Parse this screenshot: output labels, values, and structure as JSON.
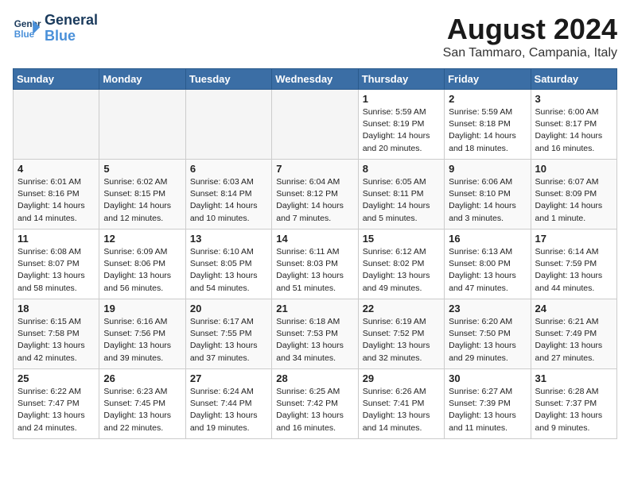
{
  "logo": {
    "line1": "General",
    "line2": "Blue"
  },
  "title": "August 2024",
  "location": "San Tammaro, Campania, Italy",
  "days_of_week": [
    "Sunday",
    "Monday",
    "Tuesday",
    "Wednesday",
    "Thursday",
    "Friday",
    "Saturday"
  ],
  "weeks": [
    [
      {
        "num": "",
        "info": ""
      },
      {
        "num": "",
        "info": ""
      },
      {
        "num": "",
        "info": ""
      },
      {
        "num": "",
        "info": ""
      },
      {
        "num": "1",
        "info": "Sunrise: 5:59 AM\nSunset: 8:19 PM\nDaylight: 14 hours\nand 20 minutes."
      },
      {
        "num": "2",
        "info": "Sunrise: 5:59 AM\nSunset: 8:18 PM\nDaylight: 14 hours\nand 18 minutes."
      },
      {
        "num": "3",
        "info": "Sunrise: 6:00 AM\nSunset: 8:17 PM\nDaylight: 14 hours\nand 16 minutes."
      }
    ],
    [
      {
        "num": "4",
        "info": "Sunrise: 6:01 AM\nSunset: 8:16 PM\nDaylight: 14 hours\nand 14 minutes."
      },
      {
        "num": "5",
        "info": "Sunrise: 6:02 AM\nSunset: 8:15 PM\nDaylight: 14 hours\nand 12 minutes."
      },
      {
        "num": "6",
        "info": "Sunrise: 6:03 AM\nSunset: 8:14 PM\nDaylight: 14 hours\nand 10 minutes."
      },
      {
        "num": "7",
        "info": "Sunrise: 6:04 AM\nSunset: 8:12 PM\nDaylight: 14 hours\nand 7 minutes."
      },
      {
        "num": "8",
        "info": "Sunrise: 6:05 AM\nSunset: 8:11 PM\nDaylight: 14 hours\nand 5 minutes."
      },
      {
        "num": "9",
        "info": "Sunrise: 6:06 AM\nSunset: 8:10 PM\nDaylight: 14 hours\nand 3 minutes."
      },
      {
        "num": "10",
        "info": "Sunrise: 6:07 AM\nSunset: 8:09 PM\nDaylight: 14 hours\nand 1 minute."
      }
    ],
    [
      {
        "num": "11",
        "info": "Sunrise: 6:08 AM\nSunset: 8:07 PM\nDaylight: 13 hours\nand 58 minutes."
      },
      {
        "num": "12",
        "info": "Sunrise: 6:09 AM\nSunset: 8:06 PM\nDaylight: 13 hours\nand 56 minutes."
      },
      {
        "num": "13",
        "info": "Sunrise: 6:10 AM\nSunset: 8:05 PM\nDaylight: 13 hours\nand 54 minutes."
      },
      {
        "num": "14",
        "info": "Sunrise: 6:11 AM\nSunset: 8:03 PM\nDaylight: 13 hours\nand 51 minutes."
      },
      {
        "num": "15",
        "info": "Sunrise: 6:12 AM\nSunset: 8:02 PM\nDaylight: 13 hours\nand 49 minutes."
      },
      {
        "num": "16",
        "info": "Sunrise: 6:13 AM\nSunset: 8:00 PM\nDaylight: 13 hours\nand 47 minutes."
      },
      {
        "num": "17",
        "info": "Sunrise: 6:14 AM\nSunset: 7:59 PM\nDaylight: 13 hours\nand 44 minutes."
      }
    ],
    [
      {
        "num": "18",
        "info": "Sunrise: 6:15 AM\nSunset: 7:58 PM\nDaylight: 13 hours\nand 42 minutes."
      },
      {
        "num": "19",
        "info": "Sunrise: 6:16 AM\nSunset: 7:56 PM\nDaylight: 13 hours\nand 39 minutes."
      },
      {
        "num": "20",
        "info": "Sunrise: 6:17 AM\nSunset: 7:55 PM\nDaylight: 13 hours\nand 37 minutes."
      },
      {
        "num": "21",
        "info": "Sunrise: 6:18 AM\nSunset: 7:53 PM\nDaylight: 13 hours\nand 34 minutes."
      },
      {
        "num": "22",
        "info": "Sunrise: 6:19 AM\nSunset: 7:52 PM\nDaylight: 13 hours\nand 32 minutes."
      },
      {
        "num": "23",
        "info": "Sunrise: 6:20 AM\nSunset: 7:50 PM\nDaylight: 13 hours\nand 29 minutes."
      },
      {
        "num": "24",
        "info": "Sunrise: 6:21 AM\nSunset: 7:49 PM\nDaylight: 13 hours\nand 27 minutes."
      }
    ],
    [
      {
        "num": "25",
        "info": "Sunrise: 6:22 AM\nSunset: 7:47 PM\nDaylight: 13 hours\nand 24 minutes."
      },
      {
        "num": "26",
        "info": "Sunrise: 6:23 AM\nSunset: 7:45 PM\nDaylight: 13 hours\nand 22 minutes."
      },
      {
        "num": "27",
        "info": "Sunrise: 6:24 AM\nSunset: 7:44 PM\nDaylight: 13 hours\nand 19 minutes."
      },
      {
        "num": "28",
        "info": "Sunrise: 6:25 AM\nSunset: 7:42 PM\nDaylight: 13 hours\nand 16 minutes."
      },
      {
        "num": "29",
        "info": "Sunrise: 6:26 AM\nSunset: 7:41 PM\nDaylight: 13 hours\nand 14 minutes."
      },
      {
        "num": "30",
        "info": "Sunrise: 6:27 AM\nSunset: 7:39 PM\nDaylight: 13 hours\nand 11 minutes."
      },
      {
        "num": "31",
        "info": "Sunrise: 6:28 AM\nSunset: 7:37 PM\nDaylight: 13 hours\nand 9 minutes."
      }
    ]
  ]
}
